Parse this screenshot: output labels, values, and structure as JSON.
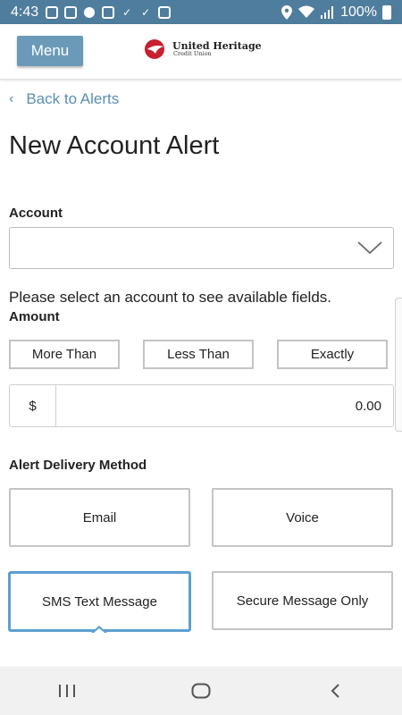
{
  "status_bar": {
    "time": "4:43",
    "battery": "100%",
    "icons": [
      "gmail-icon",
      "mail-icon",
      "circle-notification-icon",
      "image-icon",
      "check-icon",
      "check-icon",
      "close-box-icon",
      "location-icon",
      "wifi-icon",
      "signal-icon",
      "battery-icon"
    ]
  },
  "header": {
    "menu_label": "Menu",
    "logo_name": "United Heritage",
    "logo_subtitle": "Credit Union"
  },
  "nav": {
    "back_label": "Back to Alerts"
  },
  "page": {
    "title": "New Account Alert"
  },
  "form": {
    "account_label": "Account",
    "account_value": "",
    "help_text": "Please select an account to see available fields.",
    "amount_label": "Amount",
    "comparison_options": [
      "More Than",
      "Less Than",
      "Exactly"
    ],
    "currency_symbol": "$",
    "amount_value": "0.00",
    "delivery_label": "Alert Delivery Method",
    "delivery_options": [
      "Email",
      "Voice",
      "SMS Text Message",
      "Secure Message Only"
    ],
    "selected_delivery": "SMS Text Message"
  },
  "colors": {
    "status_bar": "#4f7d9d",
    "menu_button": "#6b9ab8",
    "link": "#5a8fb5",
    "selected_border": "#5da0d0"
  },
  "system_nav": {
    "icons": [
      "recent-apps-icon",
      "home-icon",
      "back-icon"
    ]
  }
}
